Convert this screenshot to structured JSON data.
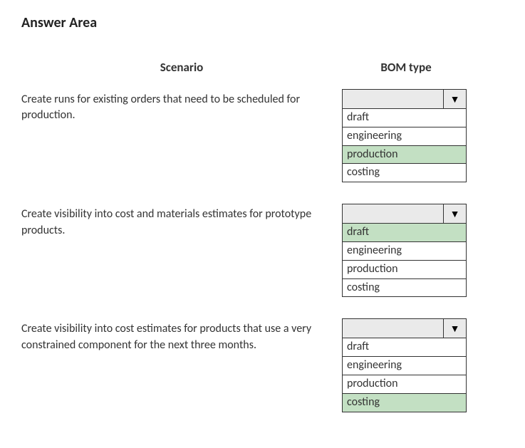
{
  "title": "Answer Area",
  "headers": {
    "scenario": "Scenario",
    "bom": "BOM type"
  },
  "rows": [
    {
      "scenario": "Create runs for existing orders that need to be scheduled for production.",
      "options": [
        "draft",
        "engineering",
        "production",
        "costing"
      ],
      "selected": 2
    },
    {
      "scenario": "Create visibility into cost and materials estimates for prototype products.",
      "options": [
        "draft",
        "engineering",
        "production",
        "costing"
      ],
      "selected": 0
    },
    {
      "scenario": "Create visibility into cost estimates for products that use a very constrained component for the next three months.",
      "options": [
        "draft",
        "engineering",
        "production",
        "costing"
      ],
      "selected": 3
    }
  ]
}
